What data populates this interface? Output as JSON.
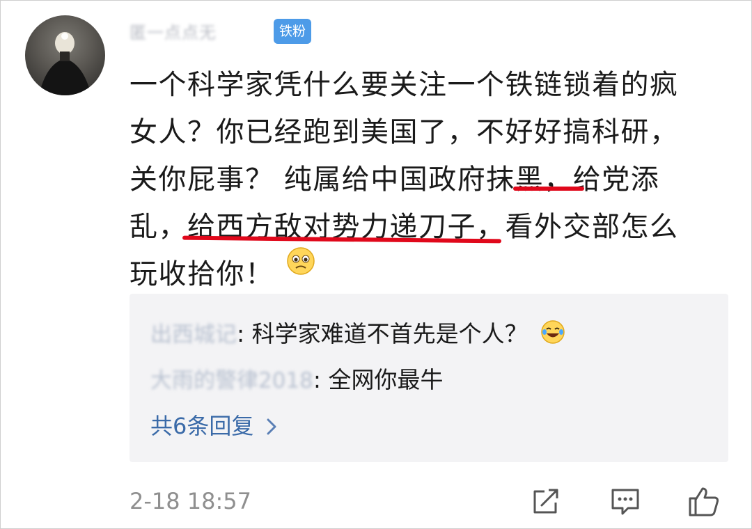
{
  "post": {
    "username": "匿一点点无",
    "badge": "铁粉",
    "comment_lines": [
      "一个科学家凭什么要关注一个铁链锁着的疯",
      "女人？你已经跑到美国了，不好好搞科研，",
      "关你屁事？ 纯属给中国政府抹黑，给党添",
      "乱，给西方敌对势力递刀子，看外交部怎么",
      "玩收拾你！"
    ],
    "emoji": "sad-face-emoji",
    "timestamp": "2-18 18:57"
  },
  "replies": {
    "items": [
      {
        "name": "出西城记",
        "sep": ":",
        "text": " 科学家难道不首先是个人？",
        "emoji": "laugh-cry-emoji"
      },
      {
        "name": "大雨的警律2018",
        "sep": ":",
        "text": " 全网你最牛"
      }
    ],
    "more_label": "共6条回复",
    "more_icon": "chevron-right-icon"
  },
  "actions": {
    "icons": [
      "share-icon",
      "comment-icon",
      "like-icon"
    ]
  },
  "colors": {
    "badge": "#4d9be8",
    "link": "#3a6aa8",
    "underline": "#e0081b",
    "reply_bg": "#f3f3f5"
  }
}
